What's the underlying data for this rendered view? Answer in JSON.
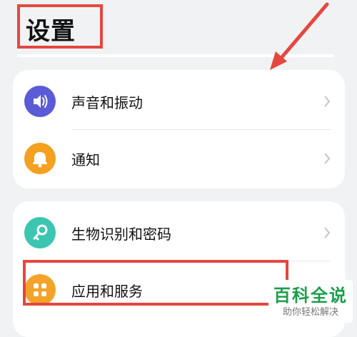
{
  "header": {
    "title": "设置"
  },
  "card1": {
    "items": [
      {
        "label": "声音和振动",
        "icon": "speaker-icon",
        "icon_color": "#5b5bd6"
      },
      {
        "label": "通知",
        "icon": "bell-icon",
        "icon_color": "#f4a020"
      }
    ]
  },
  "card2": {
    "items": [
      {
        "label": "生物识别和密码",
        "icon": "key-icon",
        "icon_color": "#3cc5b0"
      },
      {
        "label": "应用和服务",
        "icon": "apps-grid-icon",
        "icon_color": "#f3a32a"
      }
    ]
  },
  "annotation": {
    "color": "#e5473e"
  },
  "watermark": {
    "title": "百科全说",
    "subtitle": "助你轻松解决"
  }
}
